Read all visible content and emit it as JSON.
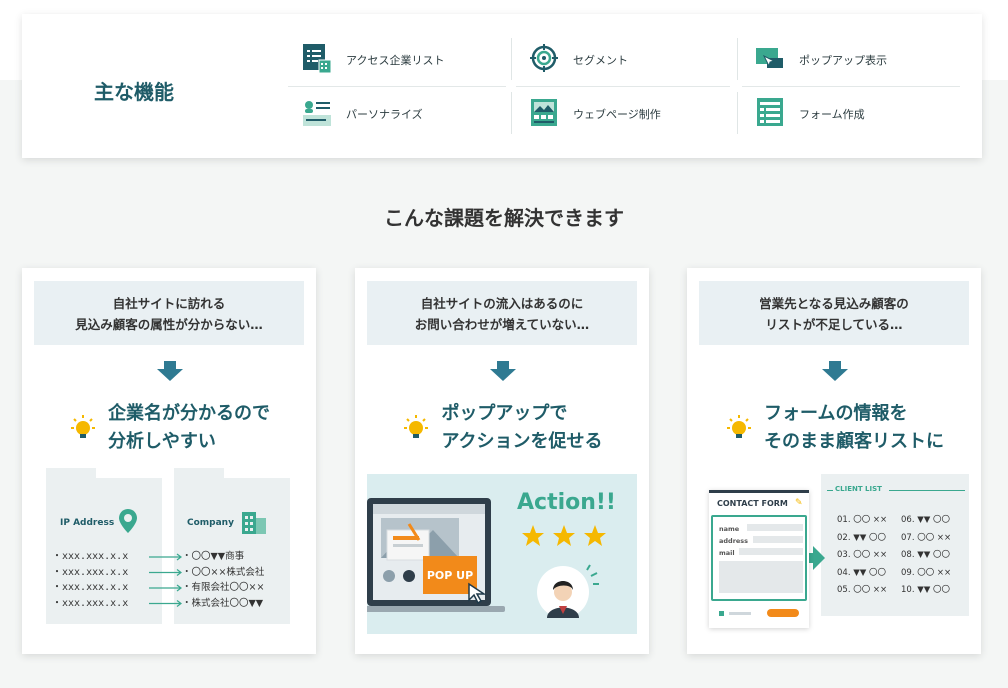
{
  "features": {
    "title": "主な機能",
    "items": [
      {
        "label": "アクセス企業リスト",
        "icon": "company-list-icon"
      },
      {
        "label": "セグメント",
        "icon": "target-icon"
      },
      {
        "label": "ポップアップ表示",
        "icon": "popup-icon"
      },
      {
        "label": "パーソナライズ",
        "icon": "profile-card-icon"
      },
      {
        "label": "ウェブページ制作",
        "icon": "webpage-icon"
      },
      {
        "label": "フォーム作成",
        "icon": "form-icon"
      }
    ]
  },
  "section_title": "こんな課題を解決できます",
  "cards": [
    {
      "problem_line1": "自社サイトに訪れる",
      "problem_line2": "見込み顧客の属性が分からない…",
      "benefit_line1": "企業名が分かるので",
      "benefit_line2": "分析しやすい",
      "ip_title": "IP Address",
      "company_title": "Company",
      "ips": [
        "・xxx.xxx.x.x",
        "・xxx.xxx.x.x",
        "・xxx.xxx.x.x",
        "・xxx.xxx.x.x"
      ],
      "companies": [
        "・〇〇▼▼商事",
        "・〇〇××株式会社",
        "・有限会社〇〇××",
        "・株式会社〇〇▼▼"
      ]
    },
    {
      "problem_line1": "自社サイトの流入はあるのに",
      "problem_line2": "お問い合わせが増えていない…",
      "benefit_line1": "ポップアップで",
      "benefit_line2": "アクションを促せる",
      "popup_label": "POP UP",
      "action_text": "Action!!"
    },
    {
      "problem_line1": "営業先となる見込み顧客の",
      "problem_line2": "リストが不足している…",
      "benefit_line1": "フォームの情報を",
      "benefit_line2": "そのまま顧客リストに",
      "form_title": "CONTACT FORM",
      "form_fields": [
        "name",
        "address",
        "mail"
      ],
      "client_list_title": "CLIENT LIST",
      "client_left": [
        "01. 〇〇 ××",
        "02. ▼▼ 〇〇",
        "03. 〇〇 ××",
        "04. ▼▼ 〇〇",
        "05. 〇〇 ××"
      ],
      "client_right": [
        "06. ▼▼ 〇〇",
        "07. 〇〇 ××",
        "08. ▼▼ 〇〇",
        "09. 〇〇 ××",
        "10. ▼▼ 〇〇"
      ]
    }
  ],
  "colors": {
    "accent": "#1f5c68",
    "green": "#3aa88f",
    "orange": "#f28a1a",
    "star": "#f5b800"
  }
}
